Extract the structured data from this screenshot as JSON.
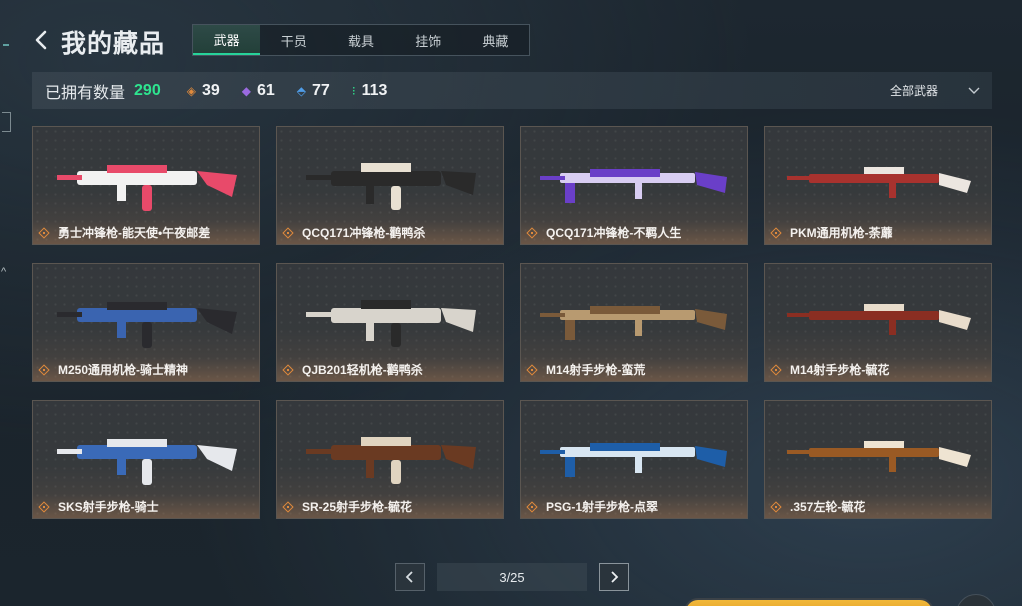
{
  "header": {
    "title": "我的藏品"
  },
  "tabs": [
    {
      "label": "武器",
      "active": true
    },
    {
      "label": "干员",
      "active": false
    },
    {
      "label": "载具",
      "active": false
    },
    {
      "label": "挂饰",
      "active": false
    },
    {
      "label": "典藏",
      "active": false
    }
  ],
  "stats": {
    "owned_label": "已拥有数量",
    "owned_count": "290",
    "tiers": [
      {
        "icon": "orange-diamond-icon",
        "color": "#e08a3c",
        "count": "39"
      },
      {
        "icon": "purple-diamond-icon",
        "color": "#9b6ae0",
        "count": "61"
      },
      {
        "icon": "blue-arrow-icon",
        "color": "#4f9de8",
        "count": "77"
      },
      {
        "icon": "green-dots-icon",
        "color": "#2ee58f",
        "count": "113"
      }
    ],
    "filter_label": "全部武器"
  },
  "items": [
    {
      "name": "勇士冲锋枪-能天使•午夜邮差",
      "palette": [
        "#e84a6a",
        "#f2f2f2"
      ]
    },
    {
      "name": "QCQ171冲锋枪-鹳鸭杀",
      "palette": [
        "#2a2a2a",
        "#e8e0d2"
      ]
    },
    {
      "name": "QCQ171冲锋枪-不羁人生",
      "palette": [
        "#6a3fc8",
        "#d8cdf2"
      ]
    },
    {
      "name": "PKM通用机枪-荼蘼",
      "palette": [
        "#a8322e",
        "#ece6e0"
      ]
    },
    {
      "name": "M250通用机枪-骑士精神",
      "palette": [
        "#2a2a2e",
        "#3a64b0"
      ]
    },
    {
      "name": "QJB201轻机枪-鹳鸭杀",
      "palette": [
        "#d8d4cc",
        "#2a2a2a"
      ]
    },
    {
      "name": "M14射手步枪-蛮荒",
      "palette": [
        "#7a5a3a",
        "#b89a70"
      ]
    },
    {
      "name": "M14射手步枪-毓花",
      "palette": [
        "#8a2e22",
        "#e8dccb"
      ]
    },
    {
      "name": "SKS射手步枪-骑士",
      "palette": [
        "#e6e8ec",
        "#3a6ab8"
      ]
    },
    {
      "name": "SR-25射手步枪-毓花",
      "palette": [
        "#6a3a22",
        "#e0d4c0"
      ]
    },
    {
      "name": "PSG-1射手步枪-点翠",
      "palette": [
        "#1e5ea8",
        "#d8e6f2"
      ]
    },
    {
      "name": ".357左轮-毓花",
      "palette": [
        "#9a5a24",
        "#efe4d2"
      ]
    }
  ],
  "pagination": {
    "text": "3/25"
  }
}
